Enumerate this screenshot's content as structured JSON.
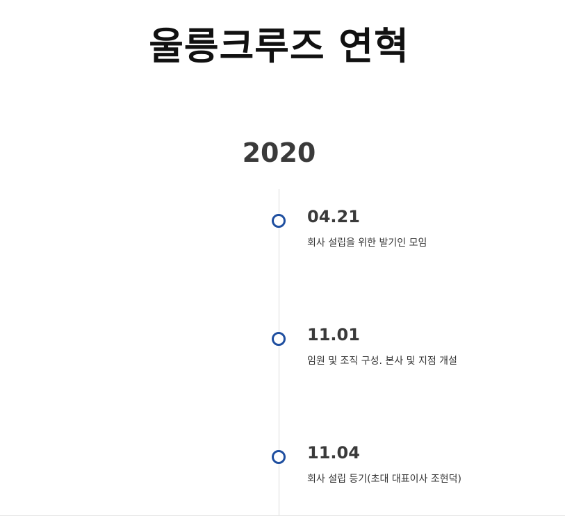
{
  "page": {
    "title": "울릉크루즈 연혁"
  },
  "timeline": {
    "year": "2020",
    "events": [
      {
        "date": "04.21",
        "description": "회사 설립을 위한 발기인 모임"
      },
      {
        "date": "11.01",
        "description": "임원 및 조직 구성. 본사 및 지점 개설"
      },
      {
        "date": "11.04",
        "description": "회사 설립 등기(초대 대표이사 조현덕)"
      }
    ]
  },
  "colors": {
    "accent": "#1f4fa0",
    "line": "#dcdcdc",
    "text": "#333333"
  }
}
